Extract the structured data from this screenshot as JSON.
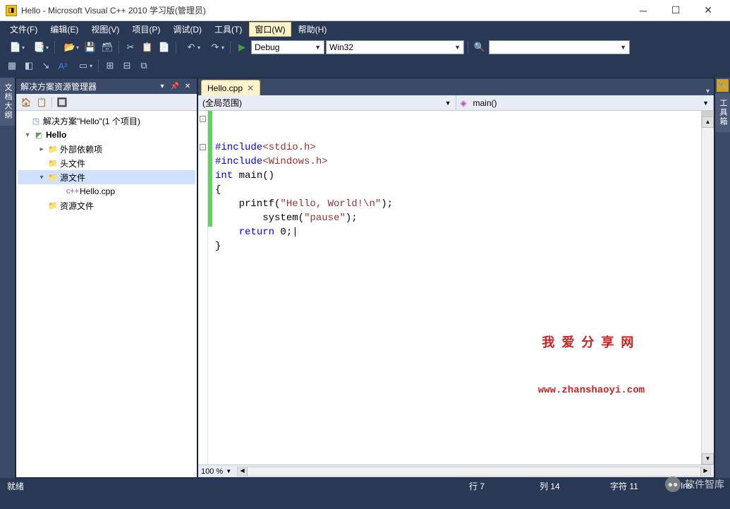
{
  "titlebar": {
    "title": "Hello - Microsoft Visual C++ 2010 学习版(管理员)"
  },
  "menu": {
    "items": [
      {
        "label": "文件(F)"
      },
      {
        "label": "编辑(E)"
      },
      {
        "label": "视图(V)"
      },
      {
        "label": "项目(P)"
      },
      {
        "label": "调试(D)"
      },
      {
        "label": "工具(T)"
      },
      {
        "label": "窗口(W)",
        "active": true
      },
      {
        "label": "帮助(H)"
      }
    ]
  },
  "toolbar": {
    "config_combo": "Debug",
    "platform_combo": "Win32"
  },
  "side_tabs": {
    "left": "文档大纲",
    "right": "工具箱"
  },
  "solution_panel": {
    "title": "解决方案资源管理器",
    "tree": {
      "root": "解决方案\"Hello\"(1 个项目)",
      "project": "Hello",
      "nodes": [
        {
          "label": "外部依赖项",
          "icon": "folder",
          "expander": "▸"
        },
        {
          "label": "头文件",
          "icon": "folder",
          "expander": ""
        },
        {
          "label": "源文件",
          "icon": "folder-open",
          "expander": "▾",
          "selected": true
        },
        {
          "label": "资源文件",
          "icon": "folder",
          "expander": ""
        }
      ],
      "source_file": "Hello.cpp"
    }
  },
  "editor": {
    "tab": "Hello.cpp",
    "scope_combo": "(全局范围)",
    "member_combo": "main()",
    "zoom": "100 %",
    "code_lines": [
      {
        "collapse": "-",
        "html": "<span class='inc'>#include</span><span class='incfile'>&lt;stdio.h&gt;</span>"
      },
      {
        "collapse": "",
        "html": "<span class='inc'>#include</span><span class='incfile'>&lt;Windows.h&gt;</span>"
      },
      {
        "collapse": "-",
        "html": "<span class='kw'>int</span> main()"
      },
      {
        "collapse": "",
        "html": "{"
      },
      {
        "collapse": "",
        "html": "    printf(<span class='str'>\"Hello, World!\\n\"</span>);"
      },
      {
        "collapse": "",
        "html": "        system(<span class='str'>\"pause\"</span>);"
      },
      {
        "collapse": "",
        "html": "    <span class='kw'>return</span> 0;",
        "cursor": true
      },
      {
        "collapse": "",
        "html": "}"
      }
    ]
  },
  "watermark": {
    "line1": "我爱分享网",
    "line2": "www.zhanshaoyi.com"
  },
  "statusbar": {
    "ready": "就绪",
    "line": "行 7",
    "col": "列 14",
    "char": "字符 11",
    "ins": "Ins"
  },
  "badge": {
    "text": "软件智库"
  }
}
